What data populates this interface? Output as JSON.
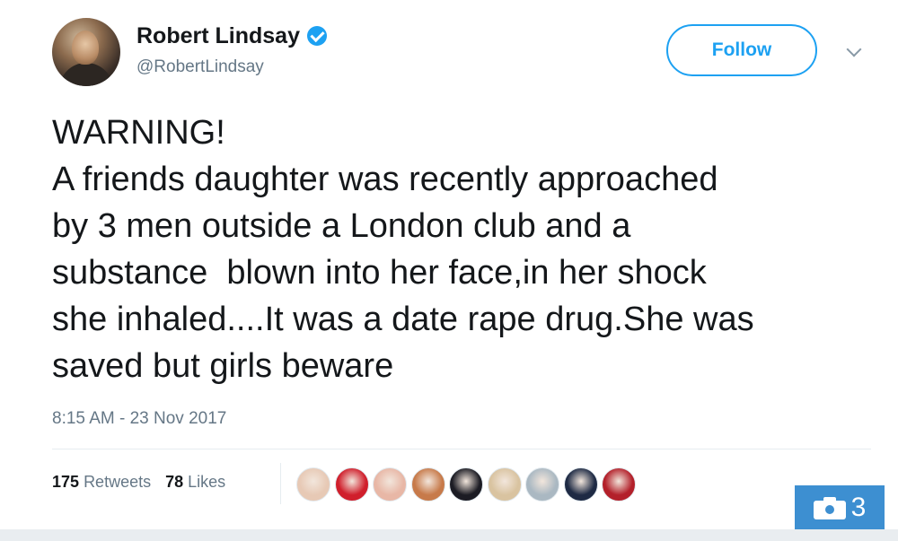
{
  "user": {
    "display_name": "Robert Lindsay",
    "handle": "@RobertLindsay"
  },
  "follow_label": "Follow",
  "tweet": {
    "text": "WARNING!\nA friends daughter was recently approached\nby 3 men outside a London club and a\nsubstance  blown into her face,in her shock\nshe inhaled....It was a date rape drug.She was\nsaved but girls beware",
    "timestamp": "8:15 AM - 23 Nov 2017"
  },
  "stats": {
    "retweets_count": "175",
    "retweets_label": "Retweets",
    "likes_count": "78",
    "likes_label": "Likes"
  },
  "likers": [
    {
      "icon": "liker-avatar-1",
      "color": "#e7c9b5"
    },
    {
      "icon": "liker-avatar-2",
      "color": "#d01f2c"
    },
    {
      "icon": "liker-avatar-3",
      "color": "#e8b7a6"
    },
    {
      "icon": "liker-avatar-4",
      "color": "#c77a4a"
    },
    {
      "icon": "liker-avatar-5",
      "color": "#1c1c24"
    },
    {
      "icon": "liker-avatar-6",
      "color": "#d9c3a0"
    },
    {
      "icon": "liker-avatar-7",
      "color": "#aab8c2"
    },
    {
      "icon": "liker-avatar-8",
      "color": "#1e2a44"
    },
    {
      "icon": "liker-avatar-9",
      "color": "#b3202a"
    }
  ],
  "photo_badge": {
    "icon": "camera-icon",
    "count": "3",
    "color": "#3d8fd1"
  },
  "colors": {
    "accent": "#1da1f2",
    "secondary_text": "#657786",
    "verified": "#1da1f2"
  }
}
